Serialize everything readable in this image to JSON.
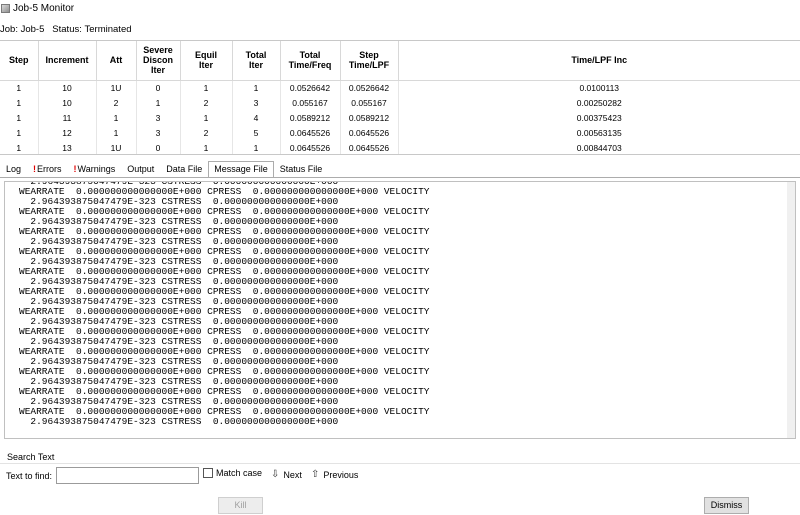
{
  "window": {
    "title": "Job-5 Monitor"
  },
  "job_info": {
    "job_label": "Job:",
    "job_name": "Job-5",
    "status_label": "Status:",
    "status_value": "Terminated"
  },
  "table": {
    "headers": [
      "Step",
      "Increment",
      "Att",
      "Severe Discon Iter",
      "Equil Iter",
      "Total Iter",
      "Total Time/Freq",
      "Step Time/LPF",
      "Time/LPF Inc"
    ],
    "rows": [
      [
        "1",
        "10",
        "1U",
        "0",
        "1",
        "1",
        "0.0526642",
        "0.0526642",
        "0.0100113"
      ],
      [
        "1",
        "10",
        "2",
        "1",
        "2",
        "3",
        "0.055167",
        "0.055167",
        "0.00250282"
      ],
      [
        "1",
        "11",
        "1",
        "3",
        "1",
        "4",
        "0.0589212",
        "0.0589212",
        "0.00375423"
      ],
      [
        "1",
        "12",
        "1",
        "3",
        "2",
        "5",
        "0.0645526",
        "0.0645526",
        "0.00563135"
      ],
      [
        "1",
        "13",
        "1U",
        "0",
        "1",
        "1",
        "0.0645526",
        "0.0645526",
        "0.00844703"
      ]
    ]
  },
  "tabs": [
    {
      "label": "Log",
      "icon": "",
      "active": false
    },
    {
      "label": "Errors",
      "icon": "!",
      "active": false
    },
    {
      "label": "Warnings",
      "icon": "!",
      "active": false
    },
    {
      "label": "Output",
      "icon": "",
      "active": false
    },
    {
      "label": "Data File",
      "icon": "",
      "active": false
    },
    {
      "label": "Message File",
      "icon": "",
      "active": true
    },
    {
      "label": "Status File",
      "icon": "",
      "active": false
    }
  ],
  "message_lines": [
    "  2.964393875047479E-323 CSTRESS  0.000000000000000E+000",
    "WEARRATE  0.000000000000000E+000 CPRESS  0.000000000000000E+000 VELOCITY",
    "  2.964393875047479E-323 CSTRESS  0.000000000000000E+000",
    "WEARRATE  0.000000000000000E+000 CPRESS  0.000000000000000E+000 VELOCITY",
    "  2.964393875047479E-323 CSTRESS  0.000000000000000E+000",
    "WEARRATE  0.000000000000000E+000 CPRESS  0.000000000000000E+000 VELOCITY",
    "  2.964393875047479E-323 CSTRESS  0.000000000000000E+000",
    "WEARRATE  0.000000000000000E+000 CPRESS  0.000000000000000E+000 VELOCITY",
    "  2.964393875047479E-323 CSTRESS  0.000000000000000E+000",
    "WEARRATE  0.000000000000000E+000 CPRESS  0.000000000000000E+000 VELOCITY",
    "  2.964393875047479E-323 CSTRESS  0.000000000000000E+000",
    "WEARRATE  0.000000000000000E+000 CPRESS  0.000000000000000E+000 VELOCITY",
    "  2.964393875047479E-323 CSTRESS  0.000000000000000E+000",
    "WEARRATE  0.000000000000000E+000 CPRESS  0.000000000000000E+000 VELOCITY",
    "  2.964393875047479E-323 CSTRESS  0.000000000000000E+000",
    "WEARRATE  0.000000000000000E+000 CPRESS  0.000000000000000E+000 VELOCITY",
    "  2.964393875047479E-323 CSTRESS  0.000000000000000E+000",
    "WEARRATE  0.000000000000000E+000 CPRESS  0.000000000000000E+000 VELOCITY",
    "  2.964393875047479E-323 CSTRESS  0.000000000000000E+000",
    "WEARRATE  0.000000000000000E+000 CPRESS  0.000000000000000E+000 VELOCITY",
    "  2.964393875047479E-323 CSTRESS  0.000000000000000E+000",
    "WEARRATE  0.000000000000000E+000 CPRESS  0.000000000000000E+000 VELOCITY",
    "  2.964393875047479E-323 CSTRESS  0.000000000000000E+000",
    "WEARRATE  0.000000000000000E+000 CPRESS  0.000000000000000E+000 VELOCITY",
    "  2.964393875047479E-323 CSTRESS  0.000000000000000E+000"
  ],
  "search": {
    "section_label": "Search Text",
    "find_label": "Text to find:",
    "find_value": "",
    "match_case_label": "Match case",
    "next_label": "Next",
    "previous_label": "Previous"
  },
  "buttons": {
    "kill_label": "Kill",
    "dismiss_label": "Dismiss"
  },
  "icons": {
    "next": "arrow-down-icon",
    "previous": "arrow-up-icon"
  },
  "colors": {
    "error_mark": "#e00000",
    "selection_border": "#acacac"
  }
}
